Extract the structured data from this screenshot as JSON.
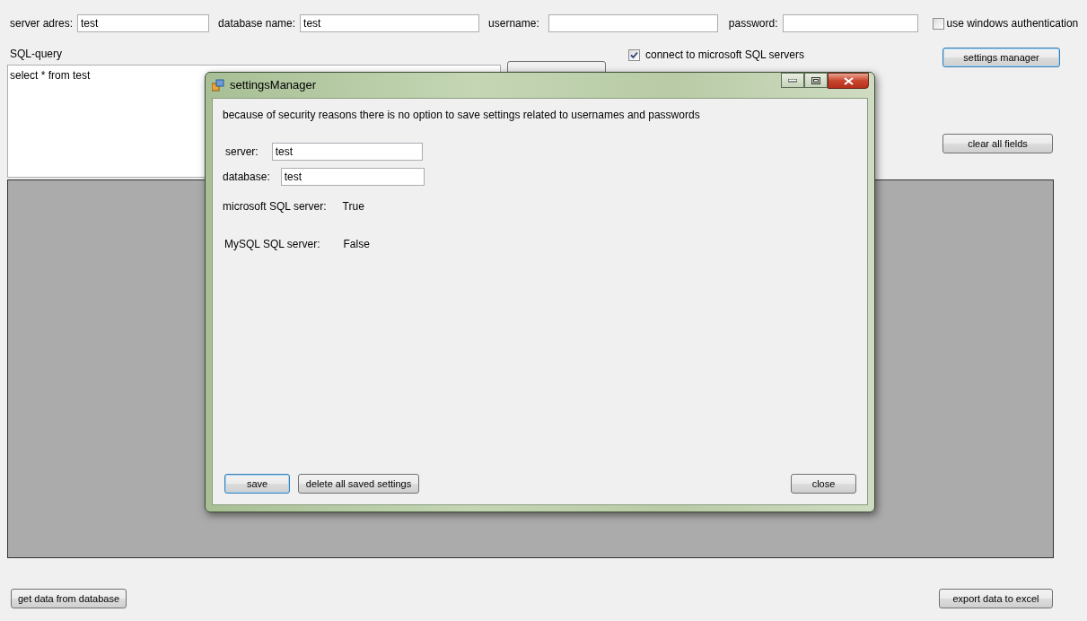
{
  "main": {
    "fields": [
      {
        "label": "server adres:",
        "value": "test"
      },
      {
        "label": "database name:",
        "value": "test"
      },
      {
        "label": "username:"
      },
      {
        "label": "password:"
      }
    ],
    "windows_auth": {
      "label": "use windows authentication",
      "checked": false
    },
    "query": {
      "label": "SQL-query",
      "value": "select * from test"
    },
    "connections": [
      {
        "label": "connect to microsoft SQL  servers",
        "checked": true
      }
    ],
    "settings_button": "settings manager",
    "clear_all_button": "clear all fields",
    "get_data_button": "get data from database",
    "export_button": "export data to excel"
  },
  "dialog": {
    "title": "settingsManager",
    "notice": "because of security reasons there is no option to save settings related to usernames and passwords",
    "fields": [
      {
        "label": "server:",
        "value": "test"
      },
      {
        "label": "database:",
        "value": "test"
      }
    ],
    "info": [
      {
        "label": "microsoft SQL server:",
        "value": "True"
      },
      {
        "label": "MySQL SQL server:",
        "value": "False"
      }
    ],
    "buttons": [
      {
        "label": "save",
        "focused": true
      },
      {
        "label": "delete all saved settings",
        "focused": false
      },
      {
        "label": "close",
        "focused": false
      }
    ]
  }
}
